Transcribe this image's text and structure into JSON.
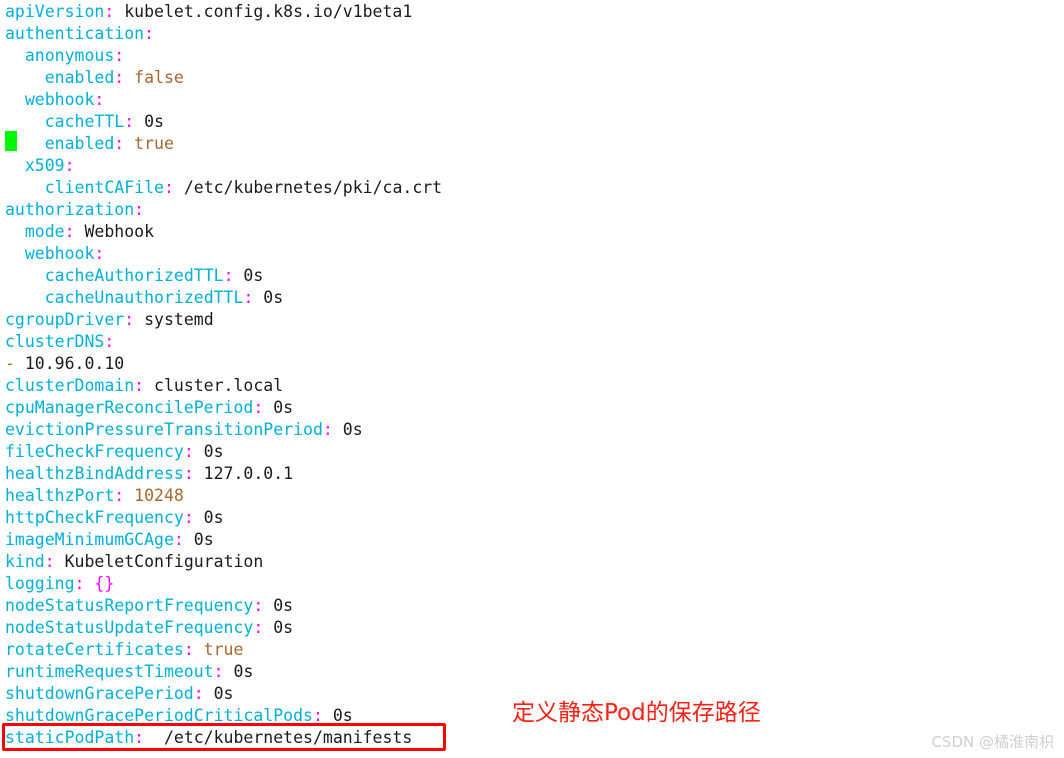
{
  "document": {
    "language": "yaml",
    "background_color": "#ffffff",
    "colors": {
      "key": "#00b0d8",
      "punctuation": "#ff00ff",
      "value": "#1a1a1a",
      "literal": "#a8672c",
      "dash": "#8a8a00",
      "cursor": "#00f900",
      "highlight": "#ff0000",
      "annotation": "#ff2015",
      "watermark": "#cfcfcf"
    },
    "lines": [
      {
        "indent": "",
        "key": "apiVersion",
        "colon": ":",
        "value": " kubelet.config.k8s.io/v1beta1",
        "value_kind": "plain"
      },
      {
        "indent": "",
        "key": "authentication",
        "colon": ":",
        "value": "",
        "value_kind": "none"
      },
      {
        "indent": "  ",
        "key": "anonymous",
        "colon": ":",
        "value": "",
        "value_kind": "none"
      },
      {
        "indent": "    ",
        "key": "enabled",
        "colon": ":",
        "value": " false",
        "value_kind": "literal"
      },
      {
        "indent": "  ",
        "key": "webhook",
        "colon": ":",
        "value": "",
        "value_kind": "none"
      },
      {
        "indent": "    ",
        "key": "cacheTTL",
        "colon": ":",
        "value": " 0s",
        "value_kind": "plain"
      },
      {
        "indent": "    ",
        "key": "enabled",
        "colon": ":",
        "value": " true",
        "value_kind": "literal",
        "cursor": true
      },
      {
        "indent": "  ",
        "key": "x509",
        "colon": ":",
        "value": "",
        "value_kind": "none"
      },
      {
        "indent": "    ",
        "key": "clientCAFile",
        "colon": ":",
        "value": " /etc/kubernetes/pki/ca.crt",
        "value_kind": "plain"
      },
      {
        "indent": "",
        "key": "authorization",
        "colon": ":",
        "value": "",
        "value_kind": "none"
      },
      {
        "indent": "  ",
        "key": "mode",
        "colon": ":",
        "value": " Webhook",
        "value_kind": "plain"
      },
      {
        "indent": "  ",
        "key": "webhook",
        "colon": ":",
        "value": "",
        "value_kind": "none"
      },
      {
        "indent": "    ",
        "key": "cacheAuthorizedTTL",
        "colon": ":",
        "value": " 0s",
        "value_kind": "plain"
      },
      {
        "indent": "    ",
        "key": "cacheUnauthorizedTTL",
        "colon": ":",
        "value": " 0s",
        "value_kind": "plain"
      },
      {
        "indent": "",
        "key": "cgroupDriver",
        "colon": ":",
        "value": " systemd",
        "value_kind": "plain"
      },
      {
        "indent": "",
        "key": "clusterDNS",
        "colon": ":",
        "value": "",
        "value_kind": "none"
      },
      {
        "indent": "",
        "dash": "-",
        "key": "",
        "colon": "",
        "value": " 10.96.0.10",
        "value_kind": "plain"
      },
      {
        "indent": "",
        "key": "clusterDomain",
        "colon": ":",
        "value": " cluster.local",
        "value_kind": "plain"
      },
      {
        "indent": "",
        "key": "cpuManagerReconcilePeriod",
        "colon": ":",
        "value": " 0s",
        "value_kind": "plain"
      },
      {
        "indent": "",
        "key": "evictionPressureTransitionPeriod",
        "colon": ":",
        "value": " 0s",
        "value_kind": "plain"
      },
      {
        "indent": "",
        "key": "fileCheckFrequency",
        "colon": ":",
        "value": " 0s",
        "value_kind": "plain"
      },
      {
        "indent": "",
        "key": "healthzBindAddress",
        "colon": ":",
        "value": " 127.0.0.1",
        "value_kind": "plain"
      },
      {
        "indent": "",
        "key": "healthzPort",
        "colon": ":",
        "value": " 10248",
        "value_kind": "literal"
      },
      {
        "indent": "",
        "key": "httpCheckFrequency",
        "colon": ":",
        "value": " 0s",
        "value_kind": "plain"
      },
      {
        "indent": "",
        "key": "imageMinimumGCAge",
        "colon": ":",
        "value": " 0s",
        "value_kind": "plain"
      },
      {
        "indent": "",
        "key": "kind",
        "colon": ":",
        "value": " KubeletConfiguration",
        "value_kind": "plain"
      },
      {
        "indent": "",
        "key": "logging",
        "colon": ":",
        "value": " {}",
        "value_kind": "braces"
      },
      {
        "indent": "",
        "key": "nodeStatusReportFrequency",
        "colon": ":",
        "value": " 0s",
        "value_kind": "plain"
      },
      {
        "indent": "",
        "key": "nodeStatusUpdateFrequency",
        "colon": ":",
        "value": " 0s",
        "value_kind": "plain"
      },
      {
        "indent": "",
        "key": "rotateCertificates",
        "colon": ":",
        "value": " true",
        "value_kind": "literal"
      },
      {
        "indent": "",
        "key": "runtimeRequestTimeout",
        "colon": ":",
        "value": " 0s",
        "value_kind": "plain"
      },
      {
        "indent": "",
        "key": "shutdownGracePeriod",
        "colon": ":",
        "value": " 0s",
        "value_kind": "plain"
      },
      {
        "indent": "",
        "key": "shutdownGracePeriodCriticalPods",
        "colon": ":",
        "value": " 0s",
        "value_kind": "plain"
      },
      {
        "indent": "",
        "key": "staticPodPath",
        "colon": ":",
        "value": "  /etc/kubernetes/manifests",
        "value_kind": "plain",
        "highlighted": true
      }
    ]
  },
  "annotation": {
    "text": "定义静态Pod的保存路径"
  },
  "watermark": {
    "text": "CSDN @橘淮南枳"
  }
}
